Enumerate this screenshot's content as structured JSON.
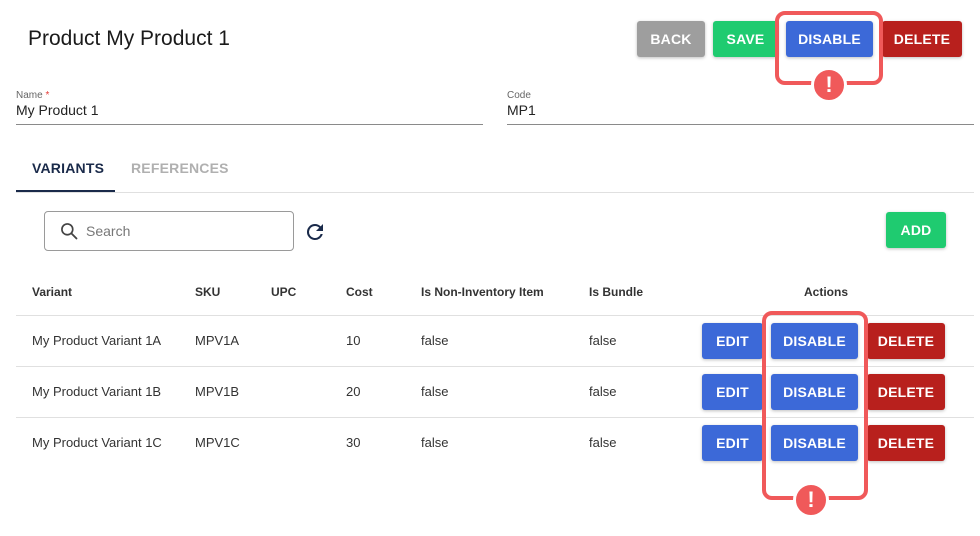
{
  "header": {
    "title": "Product My Product 1",
    "back_label": "BACK",
    "save_label": "SAVE",
    "disable_label": "DISABLE",
    "delete_label": "DELETE"
  },
  "form": {
    "name": {
      "label": "Name",
      "required_mark": "*",
      "value": "My Product 1"
    },
    "code": {
      "label": "Code",
      "value": "MP1"
    }
  },
  "tabs": [
    {
      "label": "VARIANTS",
      "active": true
    },
    {
      "label": "REFERENCES",
      "active": false
    }
  ],
  "toolbar": {
    "search_placeholder": "Search",
    "add_label": "ADD"
  },
  "table": {
    "headers": [
      "Variant",
      "SKU",
      "UPC",
      "Cost",
      "Is Non-Inventory Item",
      "Is Bundle",
      "Actions"
    ],
    "rows": [
      {
        "variant": "My Product Variant 1A",
        "sku": "MPV1A",
        "upc": "",
        "cost": "10",
        "non_inventory": "false",
        "bundle": "false"
      },
      {
        "variant": "My Product Variant 1B",
        "sku": "MPV1B",
        "upc": "",
        "cost": "20",
        "non_inventory": "false",
        "bundle": "false"
      },
      {
        "variant": "My Product Variant 1C",
        "sku": "MPV1C",
        "upc": "",
        "cost": "30",
        "non_inventory": "false",
        "bundle": "false"
      }
    ],
    "actions": {
      "edit_label": "EDIT",
      "disable_label": "DISABLE",
      "delete_label": "DELETE"
    }
  },
  "callouts": {
    "warning_symbol": "!"
  },
  "colors": {
    "primary": "#3c69d8",
    "success": "#1fcb70",
    "danger": "#b8201d",
    "neutral": "#9e9e9e",
    "callout": "#f0595a",
    "tab_active": "#1a2a4a"
  },
  "icons": {
    "search": "search-icon",
    "refresh": "refresh-icon",
    "warning": "warning-icon"
  }
}
